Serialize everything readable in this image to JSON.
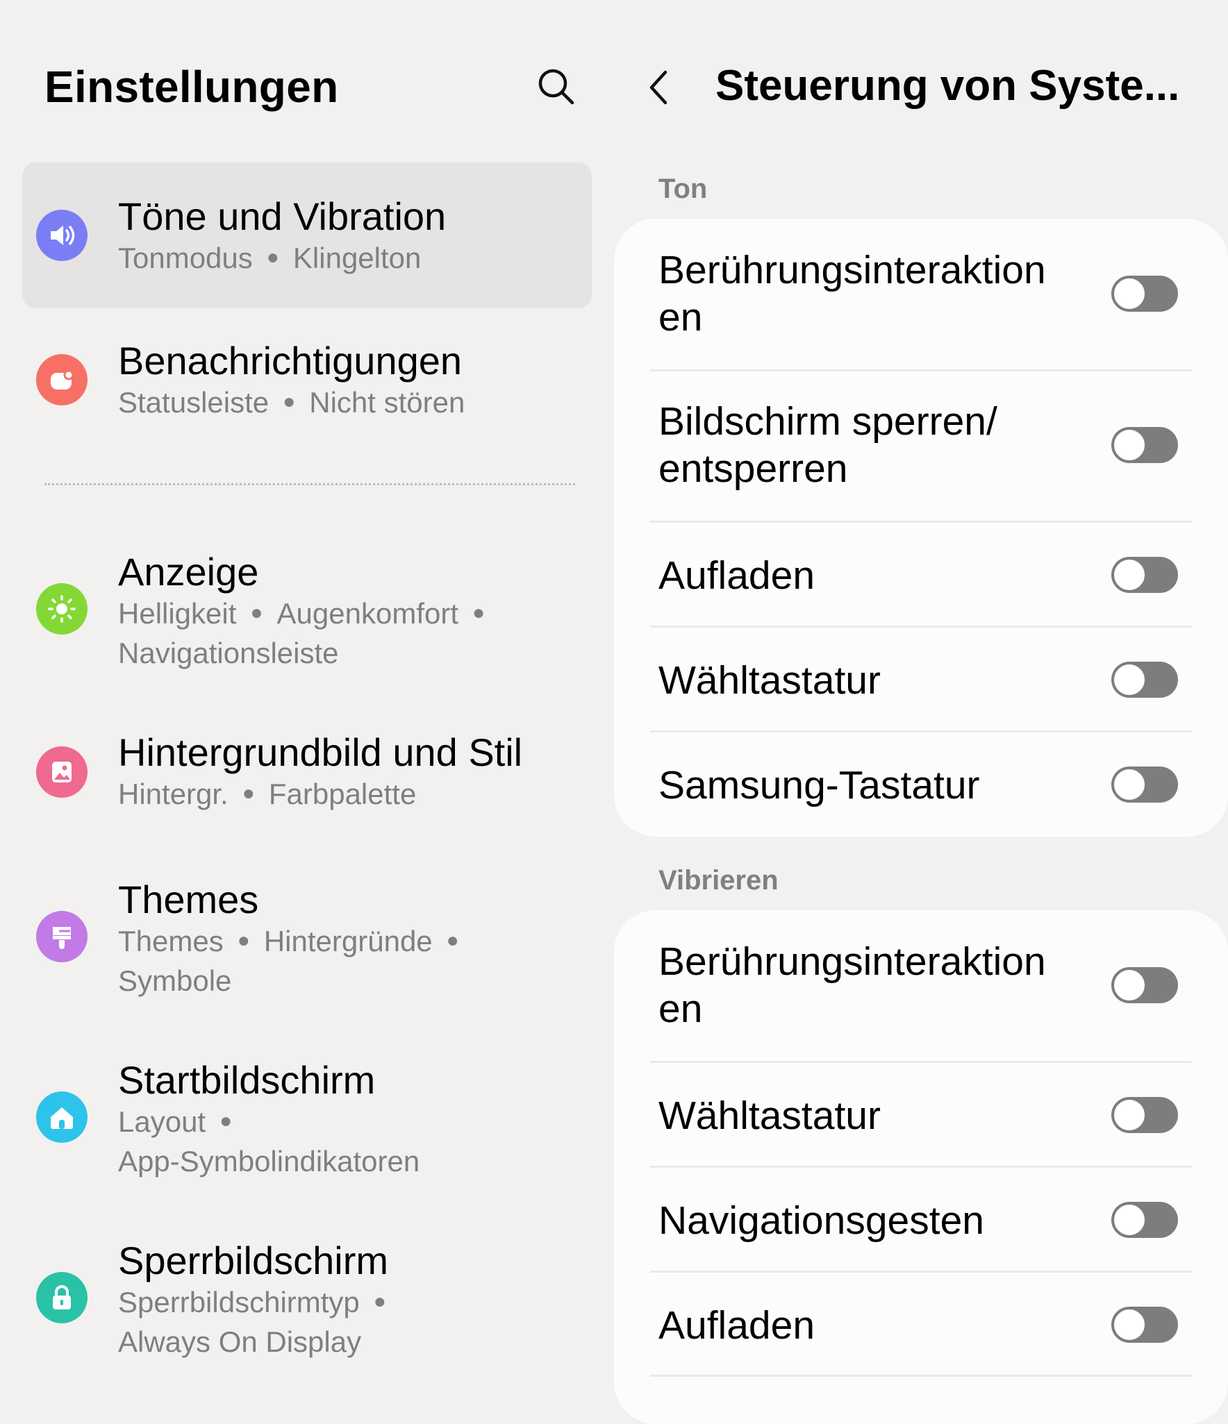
{
  "left_panel": {
    "title": "Einstellungen",
    "items": [
      {
        "title": "Töne und Vibration",
        "subtitle": [
          "Tonmodus",
          "Klingelton"
        ],
        "color": "#7b7df5",
        "icon": "speaker-icon"
      },
      {
        "title": "Benachrichtigungen",
        "subtitle": [
          "Statusleiste",
          "Nicht stören"
        ],
        "color": "#f77066",
        "icon": "notification-icon"
      },
      {
        "title": "Anzeige",
        "subtitle": [
          "Helligkeit",
          "Augenkomfort",
          "Navigationsleiste"
        ],
        "color": "#84d836",
        "icon": "sun-icon"
      },
      {
        "title": "Hintergrundbild und Stil",
        "subtitle": [
          "Hintergr.",
          "Farbpalette"
        ],
        "color": "#f0698f",
        "icon": "wallpaper-icon"
      },
      {
        "title": "Themes",
        "subtitle": [
          "Themes",
          "Hintergründe",
          "Symbole"
        ],
        "color": "#c17ae6",
        "icon": "brush-icon"
      },
      {
        "title": "Startbildschirm",
        "subtitle": [
          "Layout",
          "App-Symbolindikatoren"
        ],
        "color": "#2ec3ea",
        "icon": "home-icon"
      },
      {
        "title": "Sperrbildschirm",
        "subtitle": [
          "Sperrbildschirmtyp",
          "Always On Display"
        ],
        "color": "#2ac2a6",
        "icon": "lock-icon"
      }
    ]
  },
  "right_panel": {
    "title": "Steuerung von Syste...",
    "sections": [
      {
        "label": "Ton",
        "rows": [
          {
            "label": "Berührungsinteraktion\nen",
            "on": false
          },
          {
            "label": "Bildschirm sperren/\nentsperren",
            "on": false
          },
          {
            "label": "Aufladen",
            "on": false
          },
          {
            "label": "Wähltastatur",
            "on": false
          },
          {
            "label": "Samsung-Tastatur",
            "on": false
          }
        ]
      },
      {
        "label": "Vibrieren",
        "rows": [
          {
            "label": "Berührungsinteraktion\nen",
            "on": false
          },
          {
            "label": "Wähltastatur",
            "on": false
          },
          {
            "label": "Navigationsgesten",
            "on": false
          },
          {
            "label": "Aufladen",
            "on": false
          }
        ]
      }
    ]
  }
}
